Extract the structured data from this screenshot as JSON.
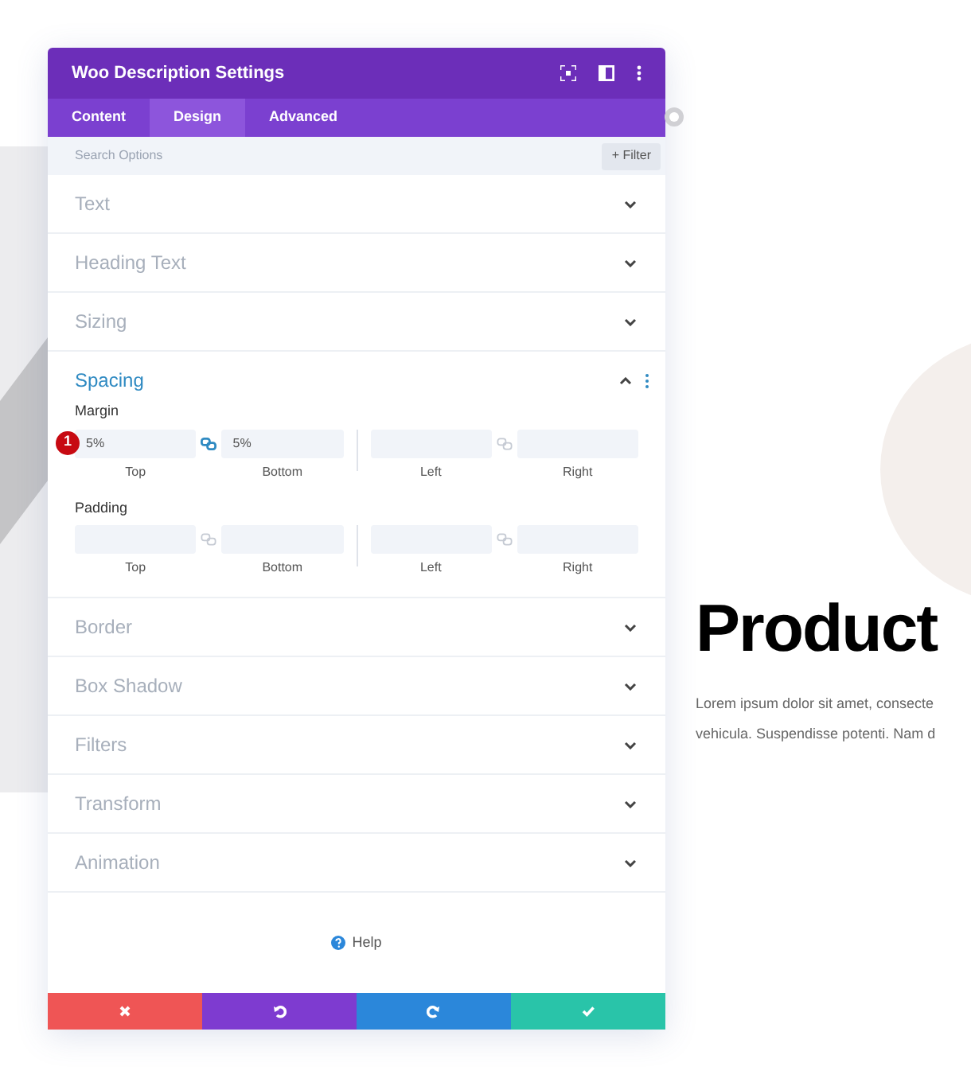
{
  "window": {
    "title": "Woo Description Settings"
  },
  "tabs": [
    {
      "label": "Content",
      "selected": false
    },
    {
      "label": "Design",
      "selected": true
    },
    {
      "label": "Advanced",
      "selected": false
    }
  ],
  "search": {
    "placeholder": "Search Options",
    "filter": "+ Filter"
  },
  "sections": [
    {
      "title": "Text",
      "expanded": false
    },
    {
      "title": "Heading Text",
      "expanded": false
    },
    {
      "title": "Sizing",
      "expanded": false
    },
    {
      "title": "Spacing",
      "expanded": true,
      "groups": [
        {
          "label": "Margin",
          "badge": "1",
          "pairs": [
            {
              "linked": true,
              "fields": [
                {
                  "value": "5%",
                  "caption": "Top"
                },
                {
                  "value": "5%",
                  "caption": "Bottom"
                }
              ]
            },
            {
              "linked": false,
              "fields": [
                {
                  "caption": "Left"
                },
                {
                  "caption": "Right"
                }
              ]
            }
          ]
        },
        {
          "label": "Padding",
          "pairs": [
            {
              "linked": false,
              "fields": [
                {
                  "caption": "Top"
                },
                {
                  "caption": "Bottom"
                }
              ]
            },
            {
              "linked": false,
              "fields": [
                {
                  "caption": "Left"
                },
                {
                  "caption": "Right"
                }
              ]
            }
          ]
        }
      ]
    },
    {
      "title": "Border",
      "expanded": false
    },
    {
      "title": "Box Shadow",
      "expanded": false
    },
    {
      "title": "Filters",
      "expanded": false
    },
    {
      "title": "Transform",
      "expanded": false
    },
    {
      "title": "Animation",
      "expanded": false
    }
  ],
  "help": "Help",
  "footer": [
    {
      "kind": "cancel"
    },
    {
      "kind": "undo"
    },
    {
      "kind": "redo"
    },
    {
      "kind": "save"
    }
  ],
  "page": {
    "heading": "Product",
    "lines": [
      "Lorem ipsum dolor sit amet, consecte",
      "vehicula. Suspendisse potenti. Nam d"
    ]
  }
}
